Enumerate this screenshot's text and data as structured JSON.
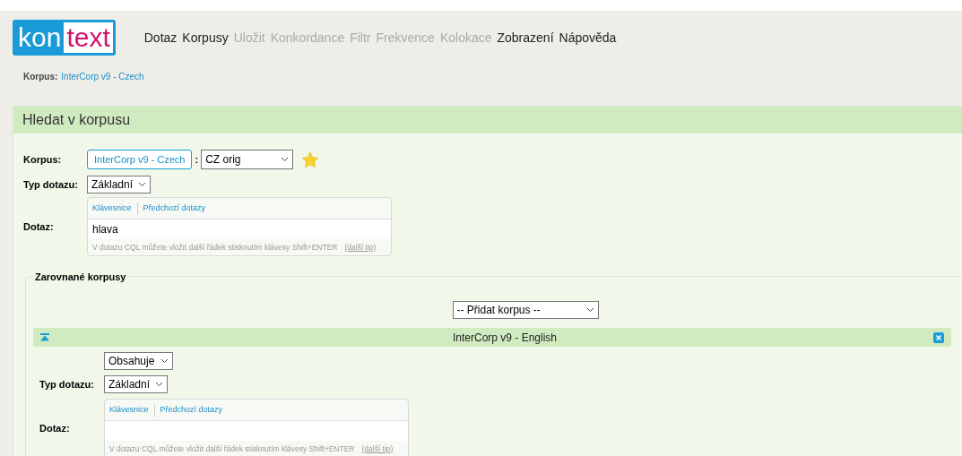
{
  "logo": {
    "part1": "kon",
    "part2": "text"
  },
  "nav": [
    {
      "label": "Dotaz",
      "disabled": false
    },
    {
      "label": "Korpusy",
      "disabled": false
    },
    {
      "label": "Uložit",
      "disabled": true
    },
    {
      "label": "Konkordance",
      "disabled": true
    },
    {
      "label": "Filtr",
      "disabled": true
    },
    {
      "label": "Frekvence",
      "disabled": true
    },
    {
      "label": "Kolokace",
      "disabled": true
    },
    {
      "label": "Zobrazení",
      "disabled": false
    },
    {
      "label": "Nápověda",
      "disabled": false
    }
  ],
  "breadcrumb": {
    "label": "Korpus:",
    "value": "InterCorp v9 - Czech"
  },
  "panel": {
    "title": "Hledat v korpusu",
    "main": {
      "corpus_label": "Korpus:",
      "corpus_button": "InterCorp v9 - Czech",
      "separator": ":",
      "subcorpus": "CZ orig",
      "query_type_label": "Typ dotazu:",
      "query_type": "Základní",
      "query_label": "Dotaz:",
      "tabs": [
        "Klávesnice",
        "Předchozí dotazy"
      ],
      "query_value": "hlava",
      "hint": "V dotazu CQL můžete vložit další řádek stisknutím klávesy Shift+ENTER",
      "hint_link": "(další tip)"
    },
    "aligned": {
      "legend": "Zarovnané korpusy",
      "add_select": "-- Přidat korpus --",
      "corpora": [
        {
          "name": "InterCorp v9 - English",
          "expanded": true,
          "filter": "Obsahuje",
          "query_type_label": "Typ dotazu:",
          "query_type": "Základní",
          "query_label": "Dotaz:",
          "tabs": [
            "Klávesnice",
            "Předchozí dotazy"
          ],
          "hint": "V dotazu CQL můžete vložit další řádek stisknutím klávesy Shift+ENTER",
          "hint_link": "(další tip)"
        }
      ]
    }
  }
}
